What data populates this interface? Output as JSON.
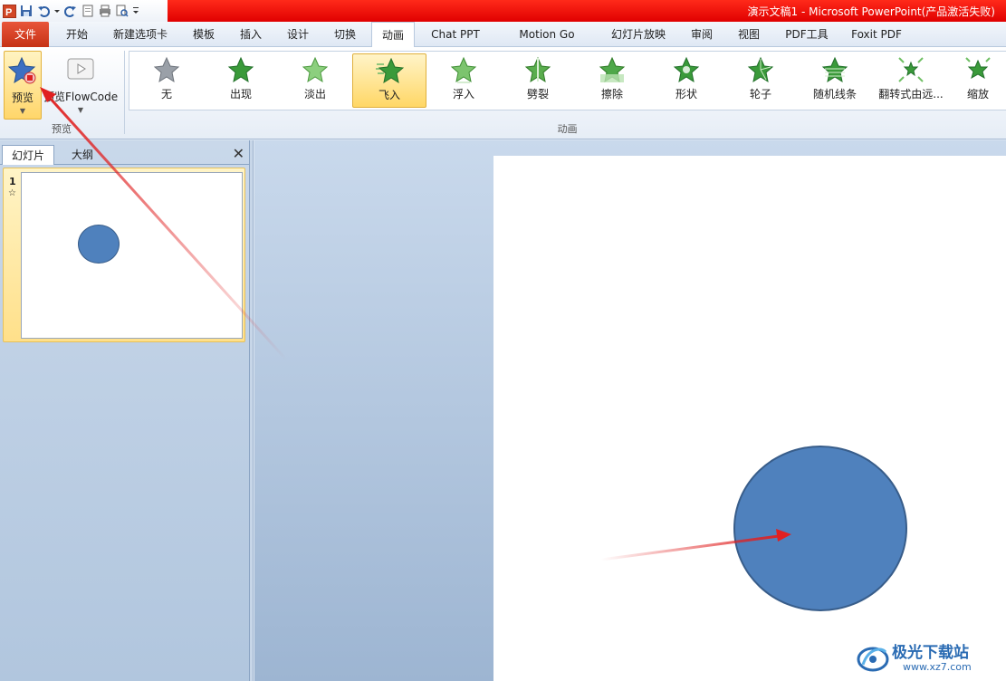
{
  "title_bar": {
    "app_title": "演示文稿1 - Microsoft PowerPoint(产品激活失败)",
    "qat_icons": [
      "powerpoint-logo-icon",
      "save-icon",
      "undo-icon",
      "redo-icon",
      "new-icon",
      "print-icon",
      "print-preview-icon",
      "customize-qat-icon"
    ]
  },
  "tabs": {
    "file": "文件",
    "items": [
      "开始",
      "新建选项卡",
      "模板",
      "插入",
      "设计",
      "切换",
      "动画",
      "Chat PPT",
      "Motion Go",
      "幻灯片放映",
      "审阅",
      "视图",
      "PDF工具",
      "Foxit PDF"
    ],
    "active": "动画"
  },
  "ribbon": {
    "preview_group": {
      "label": "预览",
      "preview_button": "预览",
      "flowcode_button": "预览FlowCode"
    },
    "animation_group": {
      "label": "动画",
      "items": [
        "无",
        "出现",
        "淡出",
        "飞入",
        "浮入",
        "劈裂",
        "擦除",
        "形状",
        "轮子",
        "随机线条",
        "翻转式由远...",
        "缩放"
      ],
      "selected": "飞入"
    }
  },
  "left_pane": {
    "tabs": [
      "幻灯片",
      "大纲"
    ],
    "active_tab": "幻灯片",
    "close_glyph": "✕",
    "slide_number": "1",
    "animation_marker": "☆"
  },
  "colors": {
    "title_red": "#e00000",
    "shape_fill": "#4f81bd",
    "shape_border": "#385d8a",
    "annotation_red": "#e02020",
    "selected_gold": "#ffd766"
  },
  "watermark": {
    "brand": "极光下载站",
    "url": "www.xz7.com"
  }
}
